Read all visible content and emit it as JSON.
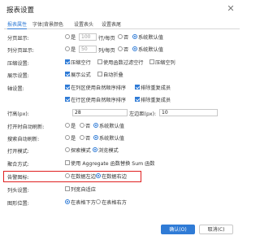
{
  "dialog": {
    "title": "报表设置",
    "close_glyph": "✕"
  },
  "tabs": [
    "报表属性",
    "字体|背景颜色",
    "设置表头",
    "设置表尾"
  ],
  "rows": {
    "paging": {
      "label": "分页显示:",
      "opt_yes": "是",
      "value": "100",
      "unit": "行/每页",
      "opt_no": "否",
      "opt_default": "系统默认值"
    },
    "colpaging": {
      "label": "列分页显示:",
      "opt_yes": "是",
      "value": "50",
      "unit": "列/每页",
      "opt_no": "否",
      "opt_default": "系统默认值"
    },
    "compress": {
      "label": "压缩设置:",
      "opt1": "压缩空行",
      "opt2": "使用函数过滤空行",
      "opt3": "压缩空列"
    },
    "display": {
      "label": "展示设置:",
      "opt1": "展示公式",
      "opt2": "自动折叠"
    },
    "sort": {
      "label": "轴设置:",
      "line1_opt1": "在列区使用自然顺序排序",
      "line1_opt2": "排除重复成员",
      "line2_opt1": "在行区使用自然顺序排序",
      "line2_opt2": "排除重复成员"
    },
    "rowheight": {
      "label": "行高(px):",
      "value": "28",
      "label2": "左边距(px):",
      "value2": "10"
    },
    "autorefresh": {
      "label": "打开时自动刷新:",
      "opt_yes": "是",
      "opt_no": "否",
      "opt_default": "系统默认值"
    },
    "searchrefresh": {
      "label": "搜索自动刷新:",
      "opt_yes": "是",
      "opt_no": "否",
      "opt_default": "系统默认值"
    },
    "openmode": {
      "label": "打开模式:",
      "opt1": "探索模式",
      "opt2": "浏览模式"
    },
    "aggregate": {
      "label": "聚合方式:",
      "opt1": "使用 Aggregate 函数替换 Sum 函数"
    },
    "alert": {
      "label": "告警图标:",
      "opt1": "在数据左边",
      "opt2": "在数据右边"
    },
    "colwidth": {
      "label": "列头设置:",
      "opt1": "列宽自适应"
    },
    "chartpos": {
      "label": "图形位置:",
      "opt1": "在表格下方",
      "opt2": "在表格右方"
    }
  },
  "footer": {
    "ok": "确认(O)",
    "cancel": "取消(C)"
  },
  "colors": {
    "accent": "#2f7bd6",
    "highlight": "#e02020"
  }
}
